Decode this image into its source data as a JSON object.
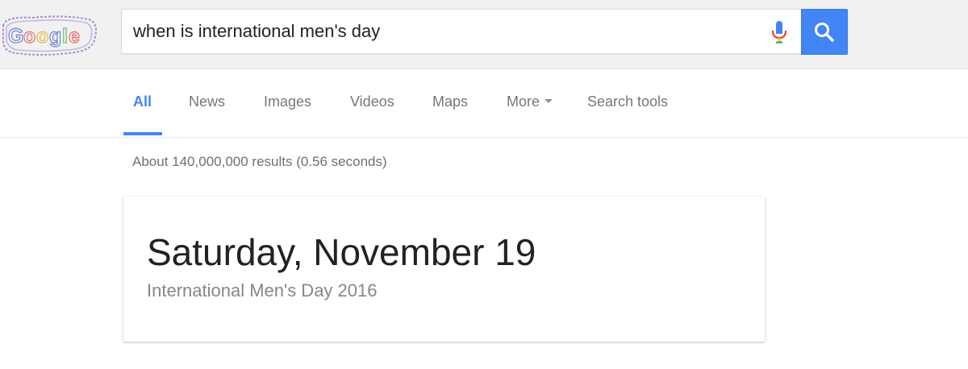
{
  "header": {
    "logo_text": "Google",
    "logo_icon": "google-doodle-logo",
    "search": {
      "value": "when is international men's day",
      "mic_icon": "microphone-icon",
      "button_icon": "magnifier-icon"
    }
  },
  "tabs": [
    {
      "label": "All",
      "active": true
    },
    {
      "label": "News"
    },
    {
      "label": "Images"
    },
    {
      "label": "Videos"
    },
    {
      "label": "Maps"
    },
    {
      "label": "More"
    },
    {
      "label": "Search tools"
    }
  ],
  "results": {
    "stats": "About 140,000,000 results (0.56 seconds)"
  },
  "answer_card": {
    "date": "Saturday, November 19",
    "subtitle": "International Men's Day 2016"
  },
  "colors": {
    "accent": "#4285f4",
    "header_bg": "#f1f1f1"
  }
}
